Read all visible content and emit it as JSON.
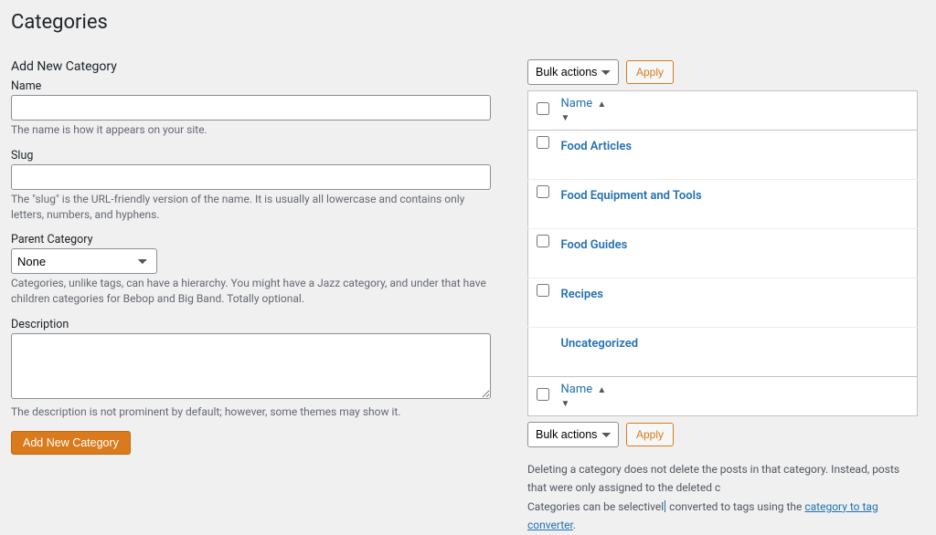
{
  "page": {
    "title": "Categories"
  },
  "form": {
    "heading": "Add New Category",
    "name": {
      "label": "Name",
      "value": "",
      "hint": "The name is how it appears on your site."
    },
    "slug": {
      "label": "Slug",
      "value": "",
      "hint": "The \"slug\" is the URL-friendly version of the name. It is usually all lowercase and contains only letters, numbers, and hyphens."
    },
    "parent": {
      "label": "Parent Category",
      "value": "None",
      "hint": "Categories, unlike tags, can have a hierarchy. You might have a Jazz category, and under that have children categories for Bebop and Big Band. Totally optional."
    },
    "description": {
      "label": "Description",
      "value": "",
      "hint": "The description is not prominent by default; however, some themes may show it."
    },
    "submit": "Add New Category"
  },
  "tablenav": {
    "bulk_label": "Bulk actions",
    "apply": "Apply"
  },
  "table": {
    "col_name": "Name",
    "rows": [
      {
        "name": "Food Articles",
        "checked": false
      },
      {
        "name": "Food Equipment and Tools",
        "checked": false
      },
      {
        "name": "Food Guides",
        "checked": false
      },
      {
        "name": "Recipes",
        "checked": false
      },
      {
        "name": "Uncategorized",
        "default": true
      }
    ]
  },
  "notes": {
    "line1": "Deleting a category does not delete the posts in that category. Instead, posts that were only assigned to the deleted c",
    "line2_pre": "Categories can be selectivel",
    "line2_post": " converted to tags using the ",
    "link": "category to tag converter",
    "period": "."
  }
}
